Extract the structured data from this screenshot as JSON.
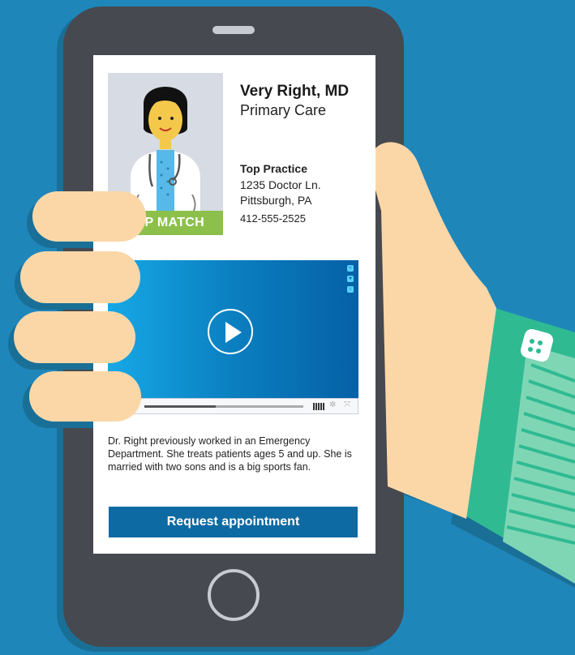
{
  "doctor": {
    "name": "Very Right, MD",
    "specialty": "Primary Care",
    "badge": "TOP MATCH",
    "practice_name": "Top Practice",
    "address_line1": "1235 Doctor Ln.",
    "address_line2": "Pittsburgh, PA",
    "phone": "412-555-2525"
  },
  "video": {
    "progress": 0.45,
    "side_icons": [
      "share-icon",
      "heart-icon",
      "info-icon"
    ],
    "control_icons": [
      "play-icon",
      "stop-icon",
      "volume-icon",
      "gear-icon",
      "fullscreen-icon"
    ]
  },
  "bio": "Dr. Right previously worked in an Emergency Department. She treats patients ages 5 and up. She is married with two sons and is a big sports fan.",
  "actions": {
    "request_label": "Request appointment"
  },
  "colors": {
    "background": "#1f86ba",
    "phone_body": "#46494f",
    "badge_green": "#8cc04b",
    "button_blue": "#0e6aa3",
    "sleeve_green": "#2fba92",
    "skin": "#fbd7a8"
  }
}
